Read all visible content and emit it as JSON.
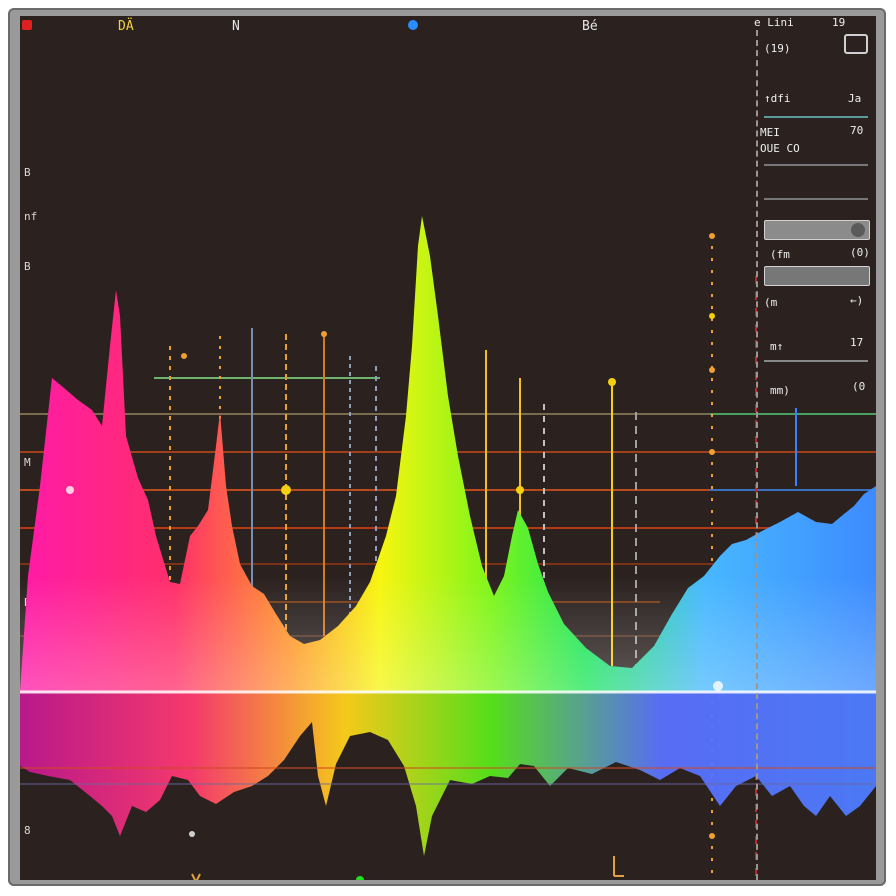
{
  "top_bar": {
    "labels": [
      "DÄ",
      "N",
      "Bé",
      "e Lini",
      "19"
    ]
  },
  "side_panel": {
    "labels": [
      "(19)",
      "↑dfi",
      "Ja",
      "MEI",
      "70",
      "OUE CO",
      "(fm",
      "(0)",
      "(m",
      "←)",
      "m↑",
      "17",
      "mm)",
      "(0"
    ]
  },
  "left_labels": [
    "B",
    "nf",
    "B",
    "M",
    "B",
    "8"
  ],
  "colors": {
    "background": "#2b2220",
    "magenta": "#ff1a8c",
    "pink": "#ff4d6d",
    "yellow": "#f5f50a",
    "green": "#33e61a",
    "blue": "#3d9bff"
  }
}
